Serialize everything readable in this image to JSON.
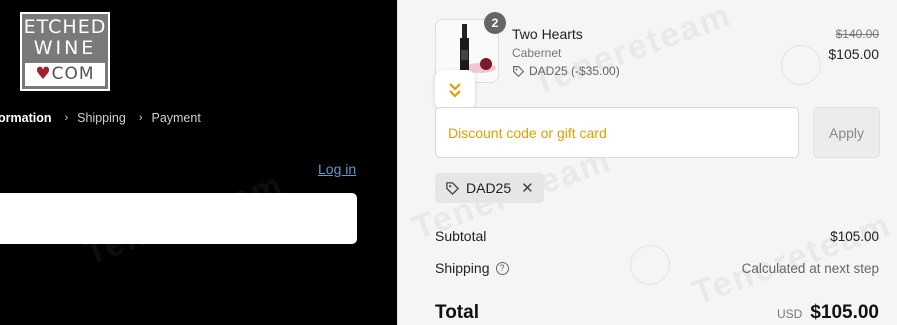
{
  "logo": {
    "line1": "ETCHED",
    "line2": "WINE",
    "line3": "COM"
  },
  "breadcrumb": {
    "current": "ormation",
    "step2": "Shipping",
    "step3": "Payment"
  },
  "login_link": "Log in",
  "contact_input": {
    "value": ""
  },
  "cart": {
    "badge_count": "2",
    "product_name": "Two Hearts",
    "product_variant": "Cabernet",
    "product_discount": "DAD25 (-$35.00)",
    "old_price": "$140.00",
    "new_price": "$105.00"
  },
  "discount": {
    "placeholder": "Discount code or gift card",
    "apply_label": "Apply",
    "applied_code": "DAD25"
  },
  "summary": {
    "subtotal_label": "Subtotal",
    "subtotal_value": "$105.00",
    "shipping_label": "Shipping",
    "shipping_value": "Calculated at next step",
    "total_label": "Total",
    "currency": "USD",
    "total_value": "$105.00"
  },
  "watermark": "Tenereteam",
  "colors": {
    "accent_link": "#5b9bd5",
    "placeholder": "#e0a000",
    "panel_left": "#000000",
    "panel_right": "#f5f5f5"
  }
}
